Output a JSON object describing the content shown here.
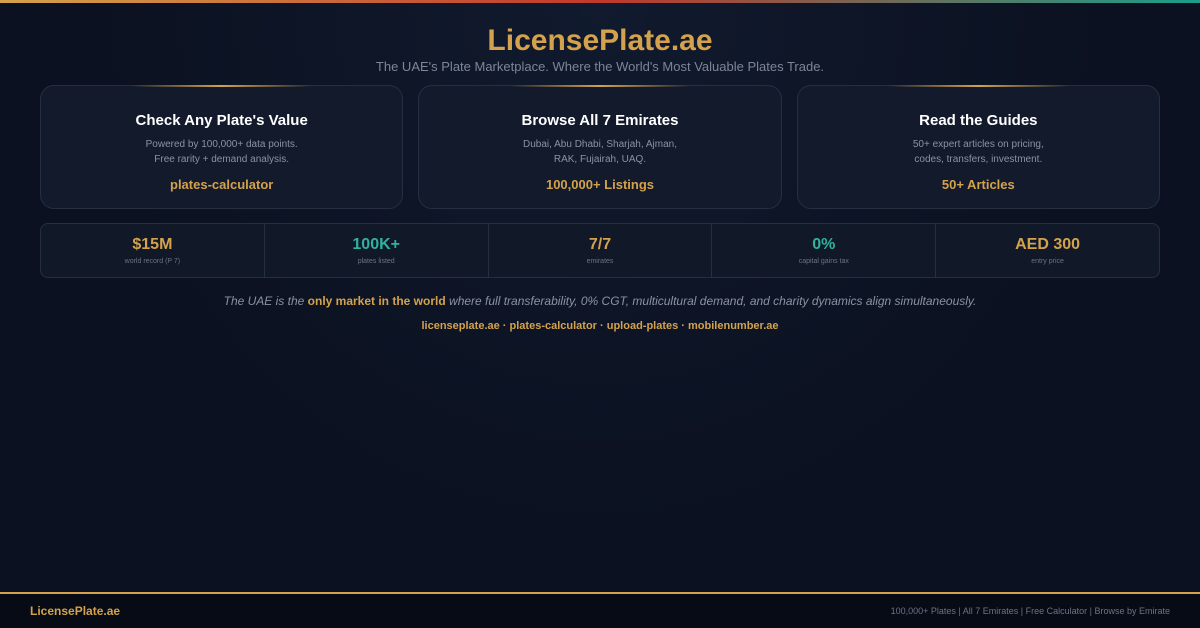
{
  "colors": {
    "accent": "#d4a24c",
    "teal": "#2fb3a0",
    "background": "#0b1120"
  },
  "header": {
    "title": "LicensePlate.ae",
    "tagline": "The UAE's Plate Marketplace. Where the World's Most Valuable Plates Trade."
  },
  "cards": [
    {
      "title": "Check Any Plate's Value",
      "desc_line1": "Powered by 100,000+ data points.",
      "desc_line2": "Free rarity + demand analysis.",
      "link": "plates-calculator"
    },
    {
      "title": "Browse All 7 Emirates",
      "desc_line1": "Dubai, Abu Dhabi, Sharjah, Ajman,",
      "desc_line2": "RAK, Fujairah, UAQ.",
      "link": "100,000+ Listings"
    },
    {
      "title": "Read the Guides",
      "desc_line1": "50+ expert articles on pricing,",
      "desc_line2": "codes, transfers, investment.",
      "link": "50+ Articles"
    }
  ],
  "stats": [
    {
      "value": "$15M",
      "label": "world record (P 7)",
      "color": "#d4a24c"
    },
    {
      "value": "100K+",
      "label": "plates listed",
      "color": "#2fb3a0"
    },
    {
      "value": "7/7",
      "label": "emirates",
      "color": "#d4a24c"
    },
    {
      "value": "0%",
      "label": "capital gains tax",
      "color": "#2fb3a0"
    },
    {
      "value": "AED 300",
      "label": "entry price",
      "color": "#d4a24c"
    }
  ],
  "statement": {
    "before": "The UAE is the ",
    "highlight": "only market in the world",
    "after": " where full transferability, 0% CGT, multicultural demand, and charity dynamics align simultaneously."
  },
  "links": [
    "licenseplate.ae",
    "plates-calculator",
    "upload-plates",
    "mobilenumber.ae"
  ],
  "link_separator": " · ",
  "footer": {
    "brand": "LicensePlate.ae",
    "meta": "100,000+ Plates | All 7 Emirates | Free Calculator | Browse by Emirate"
  }
}
